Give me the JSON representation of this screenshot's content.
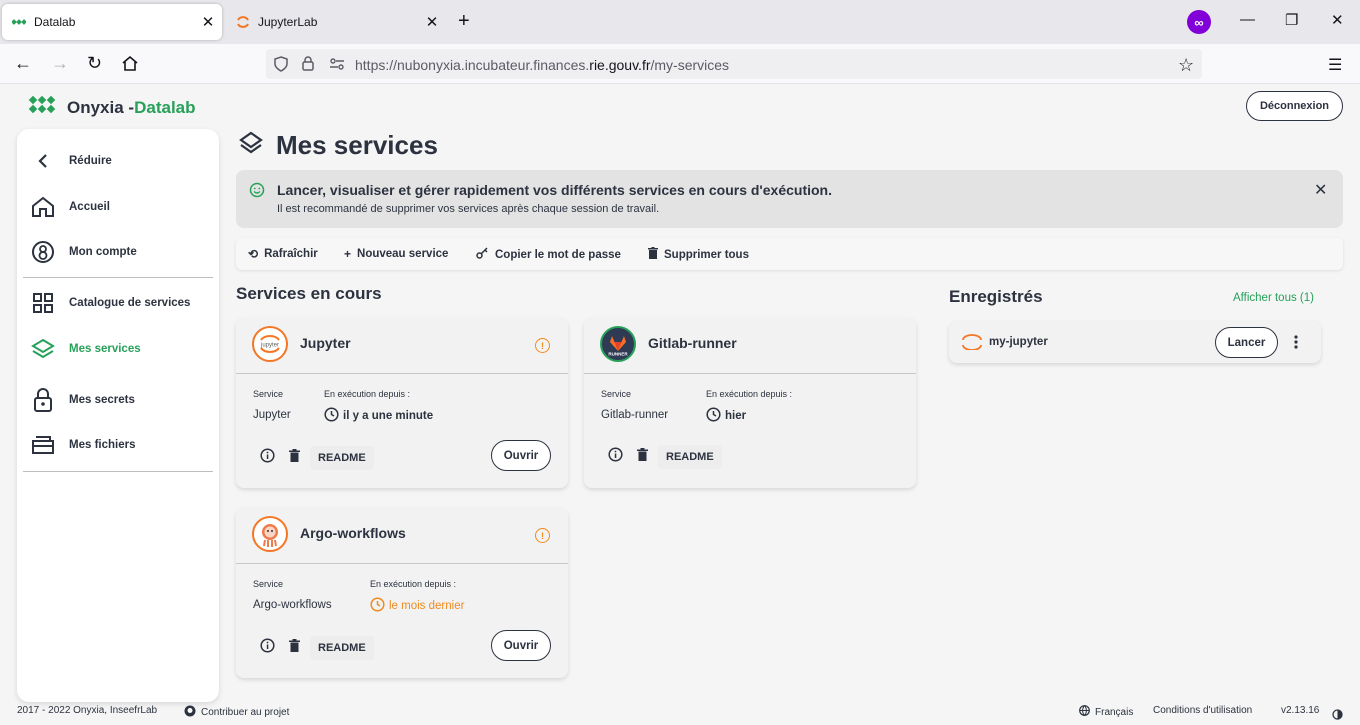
{
  "browser": {
    "tabs": [
      {
        "label": "Datalab"
      },
      {
        "label": "JupyterLab"
      }
    ],
    "url_prefix": "https://nubonyxia.incubateur.finances.",
    "url_domain": "rie.gouv.fr",
    "url_path": "/my-services"
  },
  "app": {
    "brand": "Onyxia -",
    "brand_accent": "Datalab",
    "logout_label": "Déconnexion",
    "accent_color": "#27a15a"
  },
  "sidebar": {
    "items": [
      {
        "label": "Réduire",
        "icon": "chevron-left-icon"
      },
      {
        "label": "Accueil",
        "icon": "home-icon"
      },
      {
        "label": "Mon compte",
        "icon": "account-icon"
      },
      {
        "label": "Catalogue de services",
        "icon": "grid-icon"
      },
      {
        "label": "Mes services",
        "icon": "layers-icon"
      },
      {
        "label": "Mes secrets",
        "icon": "lock-icon"
      },
      {
        "label": "Mes fichiers",
        "icon": "folder-icon"
      }
    ]
  },
  "page": {
    "title": "Mes services",
    "banner_title": "Lancer, visualiser et gérer rapidement vos différents services en cours d'exécution.",
    "banner_sub": "Il est recommandé de supprimer vos services après chaque session de travail."
  },
  "toolbar": {
    "refresh": "Rafraîchir",
    "new_service": "Nouveau service",
    "copy_password": "Copier le mot de passe",
    "delete_all": "Supprimer tous"
  },
  "running": {
    "heading": "Services en cours",
    "service_label": "Service",
    "since_label": "En exécution depuis :",
    "readme": "README",
    "open": "Ouvrir",
    "cards": [
      {
        "name": "Jupyter",
        "service": "Jupyter",
        "since": "il y a une minute"
      },
      {
        "name": "Gitlab-runner",
        "service": "Gitlab-runner",
        "since": "hier"
      },
      {
        "name": "Argo-workflows",
        "service": "Argo-workflows",
        "since": "le mois dernier"
      }
    ]
  },
  "saved": {
    "heading": "Enregistrés",
    "show_all": "Afficher tous (1)",
    "item": "my-jupyter",
    "launch": "Lancer"
  },
  "footer": {
    "copyright": "2017 - 2022 Onyxia, InseefrLab",
    "contribute": "Contribuer au projet",
    "language": "Français",
    "terms": "Conditions d'utilisation",
    "version": "v2.13.16"
  }
}
